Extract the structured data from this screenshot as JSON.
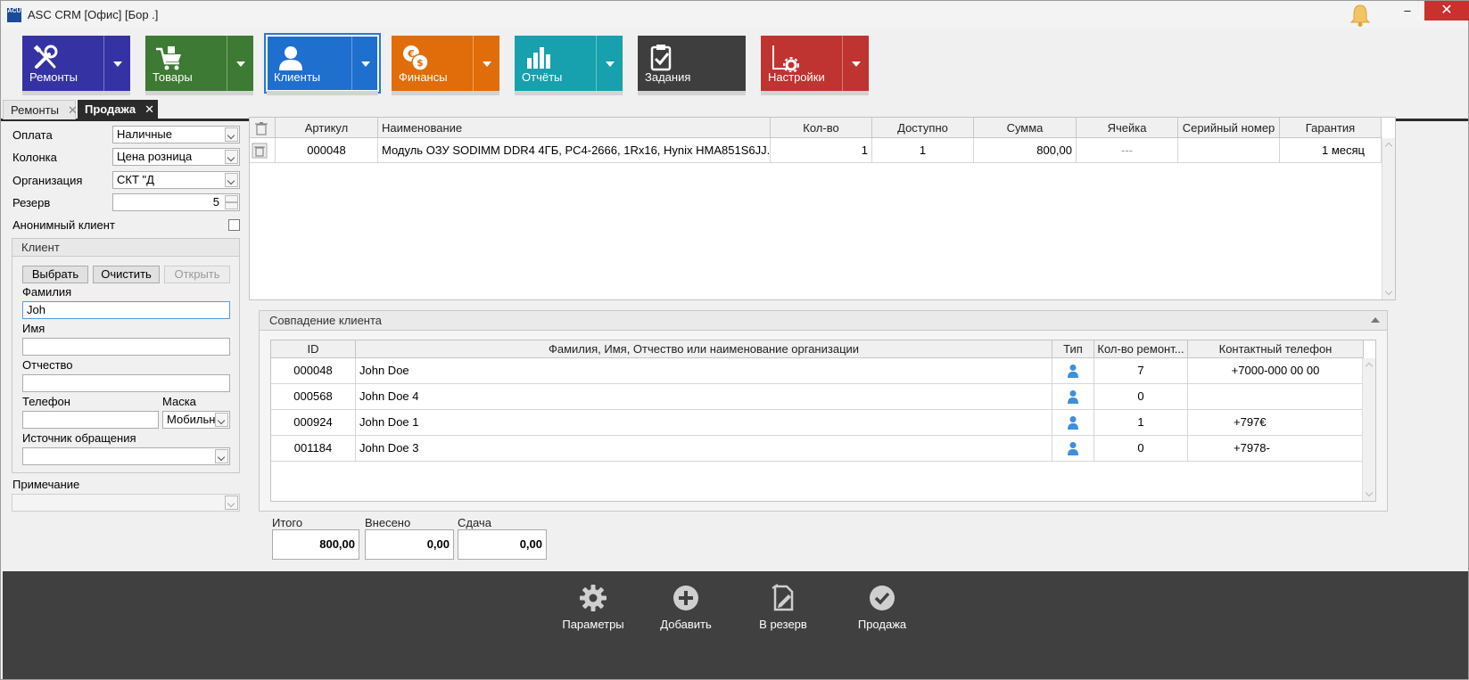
{
  "window": {
    "title": "ASC CRM [Офис] [Бор                  .]",
    "app_icon_text": "ACU"
  },
  "ribbon": [
    {
      "label": "Ремонты",
      "color": "#3532a4",
      "has_dropdown": true,
      "icon": "tools-icon"
    },
    {
      "label": "Товары",
      "color": "#3d7a33",
      "has_dropdown": true,
      "icon": "cart-icon"
    },
    {
      "label": "Клиенты",
      "color": "#1f6fcf",
      "has_dropdown": true,
      "icon": "user-icon",
      "active": true
    },
    {
      "label": "Финансы",
      "color": "#e06d09",
      "has_dropdown": true,
      "icon": "money-icon"
    },
    {
      "label": "Отчёты",
      "color": "#17a0ad",
      "has_dropdown": true,
      "icon": "chart-icon"
    },
    {
      "label": "Задания",
      "color": "#3e3e3e",
      "has_dropdown": false,
      "icon": "task-icon"
    },
    {
      "label": "Настройки",
      "color": "#bf3330",
      "has_dropdown": true,
      "icon": "settings-icon"
    }
  ],
  "tabs": [
    {
      "label": "Ремонты",
      "active": false
    },
    {
      "label": "Продажа",
      "active": true
    }
  ],
  "form": {
    "payment_label": "Оплата",
    "payment_value": "Наличные",
    "column_label": "Колонка",
    "column_value": "Цена розница",
    "org_label": "Организация",
    "org_value": "СКТ \"Д",
    "reserve_label": "Резерв",
    "reserve_value": "5",
    "anon_label": "Анонимный клиент",
    "anon_checked": false,
    "note_label": "Примечание",
    "note_value": ""
  },
  "client": {
    "group_title": "Клиент",
    "select_btn": "Выбрать",
    "clear_btn": "Очистить",
    "open_btn": "Открыть",
    "surname_label": "Фамилия",
    "surname_value": "Joh",
    "name_label": "Имя",
    "name_value": "",
    "patronymic_label": "Отчество",
    "patronymic_value": "",
    "phone_label": "Телефон",
    "phone_value": "",
    "mask_label": "Маска",
    "mask_value": "Мобильн",
    "source_label": "Источник обращения",
    "source_value": ""
  },
  "items": {
    "columns": [
      "Артикул",
      "Наименование",
      "Кол-во",
      "Доступно",
      "Сумма",
      "Ячейка",
      "Серийный номер",
      "Гарантия"
    ],
    "rows": [
      {
        "sku": "000048",
        "name": "Модуль ОЗУ SODIMM DDR4 4ГБ, PC4-2666, 1Rx16, Hynix HMA851S6JJ...",
        "qty": "1",
        "avail": "1",
        "sum": "800,00",
        "cell": "---",
        "serial": "",
        "warranty": "1 месяц"
      }
    ]
  },
  "match": {
    "title": "Совпадение клиента",
    "columns": [
      "ID",
      "Фамилия, Имя, Отчество или наименование организации",
      "Тип",
      "Кол-во ремонт...",
      "Контактный телефон"
    ],
    "rows": [
      {
        "id": "000048",
        "name": "John Doe",
        "type": "person-icon",
        "repairs": "7",
        "phone": "+7000-000 00 00"
      },
      {
        "id": "000568",
        "name": "John Doe 4",
        "type": "person-icon",
        "repairs": "0",
        "phone": ""
      },
      {
        "id": "000924",
        "name": "John Doe 1",
        "type": "person-icon",
        "repairs": "1",
        "phone": "+797€"
      },
      {
        "id": "001184",
        "name": "John Doe 3",
        "type": "person-icon",
        "repairs": "0",
        "phone": "+7978-"
      }
    ]
  },
  "totals": {
    "total_label": "Итого",
    "total_value": "800,00",
    "paid_label": "Внесено",
    "paid_value": "0,00",
    "change_label": "Сдача",
    "change_value": "0,00"
  },
  "footer": [
    {
      "label": "Параметры",
      "icon": "gear-icon"
    },
    {
      "label": "Добавить",
      "icon": "plus-circle-icon"
    },
    {
      "label": "В резерв",
      "icon": "reserve-icon"
    },
    {
      "label": "Продажа",
      "icon": "check-circle-icon"
    }
  ]
}
